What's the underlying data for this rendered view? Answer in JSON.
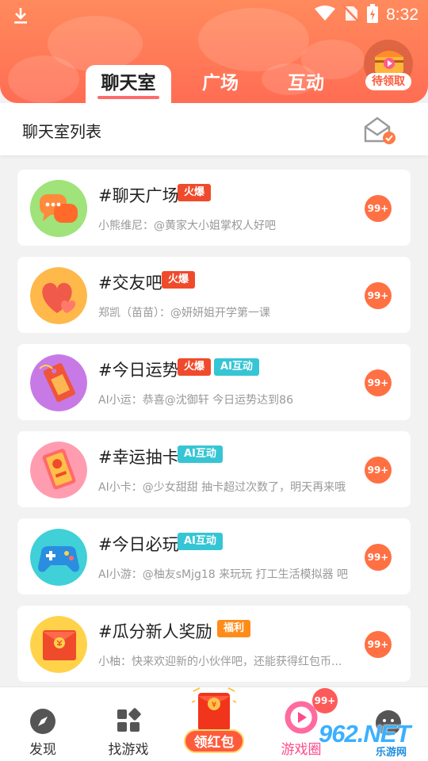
{
  "status": {
    "time": "8:32"
  },
  "header": {
    "tabs": [
      {
        "label": "聊天室",
        "active": true
      },
      {
        "label": "广场",
        "active": false
      },
      {
        "label": "互动",
        "active": false
      }
    ],
    "reward_label": "待领取",
    "accent": "#ff7a56"
  },
  "subheader": {
    "title": "聊天室列表"
  },
  "rooms": [
    {
      "title": "#聊天广场",
      "tags": [
        {
          "text": "火爆",
          "color": "#f04a2c"
        }
      ],
      "subtitle": "小熊维尼：@黄家大小姐掌权人好吧",
      "count": "99+",
      "icon": "chat-bubbles-icon"
    },
    {
      "title": "#交友吧",
      "tags": [
        {
          "text": "火爆",
          "color": "#f04a2c"
        }
      ],
      "subtitle": "郑凯（苗苗）：@妍妍姐开学第一课",
      "count": "99+",
      "icon": "hearts-icon"
    },
    {
      "title": "#今日运势",
      "tags": [
        {
          "text": "火爆",
          "color": "#f04a2c"
        },
        {
          "text": "AI互动",
          "color": "#36c5d4"
        }
      ],
      "subtitle": "AI小运：恭喜@沈御轩 今日运势达到86",
      "count": "99+",
      "icon": "fortune-tag-icon"
    },
    {
      "title": "#幸运抽卡",
      "tags": [
        {
          "text": "AI互动",
          "color": "#36c5d4"
        }
      ],
      "subtitle": "AI小卡：@少女甜甜 抽卡超过次数了，明天再来哦",
      "count": "99+",
      "icon": "lucky-card-icon"
    },
    {
      "title": "#今日必玩",
      "tags": [
        {
          "text": "AI互动",
          "color": "#36c5d4"
        }
      ],
      "subtitle": "AI小游：@柚友sMjg18 来玩玩 打工生活模拟器 吧",
      "count": "99+",
      "icon": "gamepad-icon"
    },
    {
      "title": "#瓜分新人奖励",
      "tags": [
        {
          "text": "福利",
          "color": "#ff8c1a"
        }
      ],
      "subtitle": "小柚：快来欢迎新的小伙伴吧，还能获得红包币...",
      "count": "99+",
      "icon": "red-envelope-icon"
    }
  ],
  "bottom_nav": {
    "items": [
      {
        "label": "发现",
        "icon": "compass-icon"
      },
      {
        "label": "找游戏",
        "icon": "grid-icon"
      },
      {
        "label": "领红包",
        "icon": "red-packet-icon"
      },
      {
        "label": "游戏圈",
        "icon": "ring-icon"
      }
    ],
    "badge": "99+"
  },
  "watermark": {
    "main": "962.NET",
    "sub": "乐游网"
  }
}
